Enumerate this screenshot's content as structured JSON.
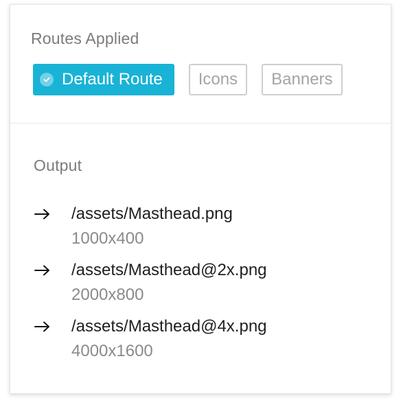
{
  "routes": {
    "title": "Routes Applied",
    "chips": [
      {
        "label": "Default Route",
        "active": true
      },
      {
        "label": "Icons",
        "active": false
      },
      {
        "label": "Banners",
        "active": false
      }
    ]
  },
  "output": {
    "title": "Output",
    "items": [
      {
        "path": "/assets/Masthead.png",
        "dimensions": "1000x400"
      },
      {
        "path": "/assets/Masthead@2x.png",
        "dimensions": "2000x800"
      },
      {
        "path": "/assets/Masthead@4x.png",
        "dimensions": "4000x1600"
      }
    ]
  },
  "colors": {
    "accent": "#19b3d6",
    "border": "#cfcfcf",
    "muted_text": "#7b7b7b"
  },
  "icons": {
    "active_chip": "check-circle-icon",
    "output_row": "arrow-right-icon"
  }
}
